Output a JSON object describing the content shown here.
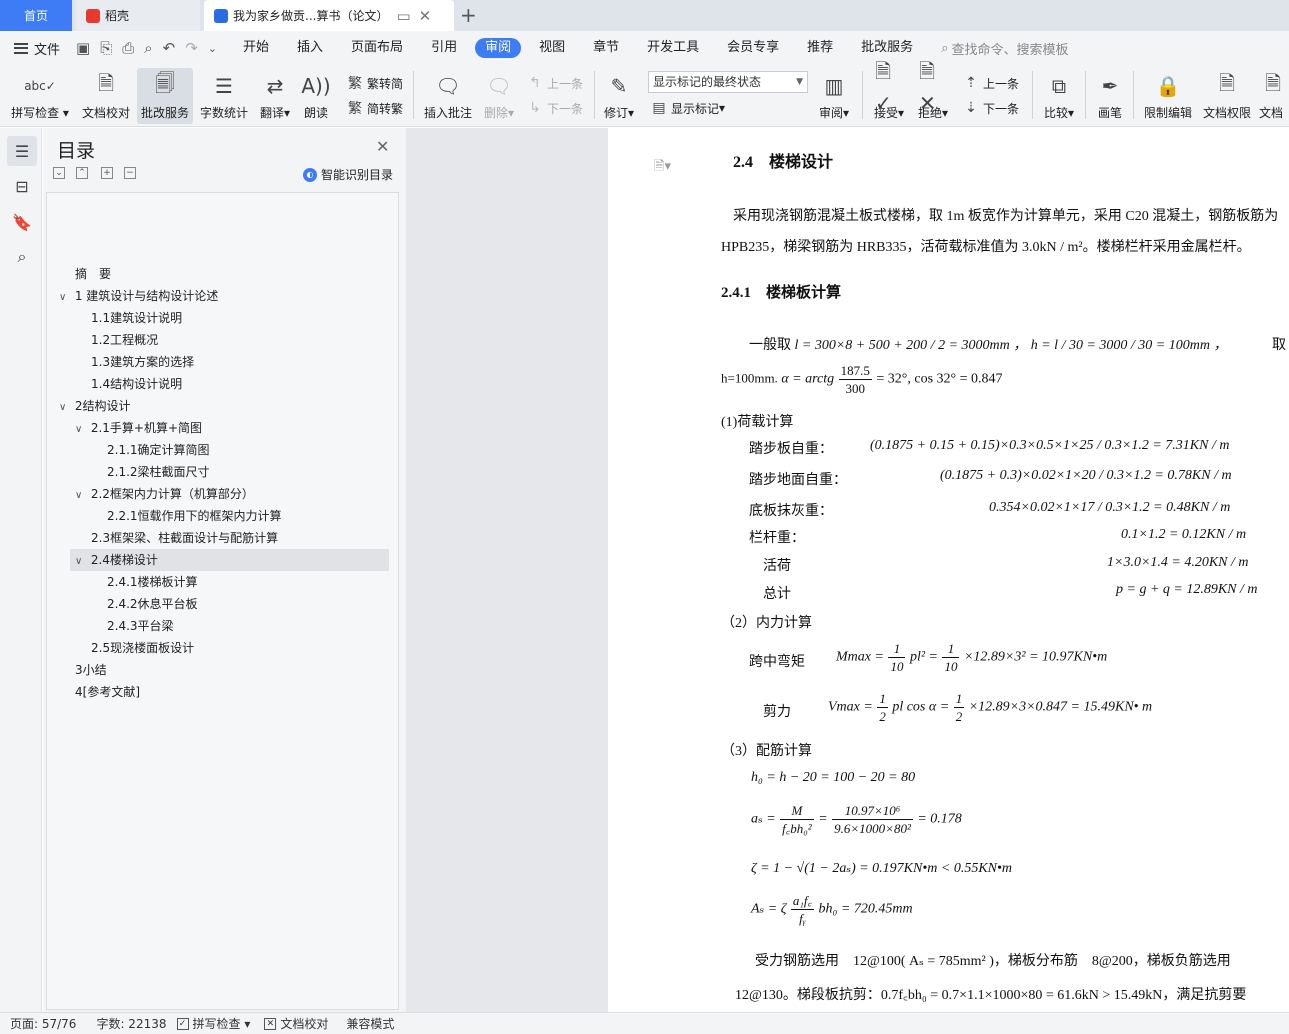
{
  "tabs": {
    "home": "首页",
    "daoke": "稻壳",
    "doc": "我为家乡做贡...算书（论文）",
    "add": "+"
  },
  "menubar": {
    "file": "文件",
    "items": [
      "开始",
      "插入",
      "页面布局",
      "引用",
      "审阅",
      "视图",
      "章节",
      "开发工具",
      "会员专享",
      "推荐",
      "批改服务"
    ],
    "active": "审阅",
    "search": "查找命令、搜索模板"
  },
  "ribbon": {
    "spell_check": "拼写检查",
    "doc_proof": "文档校对",
    "correction_service": "批改服务",
    "word_count": "字数统计",
    "translate": "翻译",
    "read_aloud": "朗读",
    "trad_to_simp": "繁转简",
    "simp_to_trad": "简转繁",
    "insert_comment": "插入批注",
    "delete": "删除",
    "prev_comment": "上一条",
    "next_comment": "下一条",
    "track_changes": "修订",
    "markup_state": "显示标记的最终状态",
    "show_markup": "显示标记",
    "review": "审阅",
    "accept": "接受",
    "reject": "拒绝",
    "prev_change": "上一条",
    "next_change": "下一条",
    "compare": "比较",
    "pen": "画笔",
    "restrict_edit": "限制编辑",
    "doc_permission": "文档权限",
    "doc_more": "文档"
  },
  "toc": {
    "title": "目录",
    "smart": "智能识别目录",
    "items": [
      {
        "label": "摘　要"
      },
      {
        "label": "1  建筑设计与结构设计论述"
      },
      {
        "label": "1.1建筑设计说明"
      },
      {
        "label": "1.2工程概况"
      },
      {
        "label": "1.3建筑方案的选择"
      },
      {
        "label": "1.4结构设计说明"
      },
      {
        "label": "2结构设计"
      },
      {
        "label": "2.1手算+机算+简图"
      },
      {
        "label": "2.1.1确定计算简图"
      },
      {
        "label": "2.1.2梁柱截面尺寸"
      },
      {
        "label": "2.2框架内力计算（机算部分）"
      },
      {
        "label": "2.2.1恒载作用下的框架内力计算"
      },
      {
        "label": "2.3框架梁、柱截面设计与配筋计算"
      },
      {
        "label": "2.4楼梯设计"
      },
      {
        "label": "2.4.1楼梯板计算"
      },
      {
        "label": "2.4.2休息平台板"
      },
      {
        "label": "2.4.3平台梁"
      },
      {
        "label": "2.5现浇楼面板设计"
      },
      {
        "label": "3小结"
      },
      {
        "label": "4[参考文献]"
      }
    ]
  },
  "doc": {
    "h1": "2.4　楼梯设计",
    "p1a": "采用现浇钢筋混凝土板式楼梯，取 1m 板宽作为计算单元，采用 C20 混凝土，钢筋板筋为",
    "p1b": "HPB235，梯梁钢筋为 HRB335，活荷载标准值为 3.0kN / m²。楼梯栏杆采用金属栏杆。",
    "h2": "2.4.1　楼梯板计算",
    "p2a_pre": "一般取",
    "p2a_math": "l = 300×8 + 500 + 200 / 2 = 3000mm ，  h = l / 30 = 3000 / 30 = 100mm ，",
    "p2a_tail": "取",
    "p2b_pre": "h=100mm.",
    "p2b_alpha": "α = arctg",
    "p2b_num": "187.5",
    "p2b_den": "300",
    "p2b_tail": "= 32°, cos 32° = 0.847",
    "load_heading": "(1)荷载计算",
    "loads": [
      {
        "label": "踏步板自重：",
        "formula": "(0.1875 + 0.15 + 0.15)×0.3×0.5×1×25 / 0.3×1.2 = 7.31KN / m"
      },
      {
        "label": "踏步地面自重：",
        "formula": "(0.1875 + 0.3)×0.02×1×20 / 0.3×1.2 = 0.78KN / m"
      },
      {
        "label": "底板抹灰重：",
        "formula": "0.354×0.02×1×17 / 0.3×1.2 = 0.48KN / m"
      },
      {
        "label": "栏杆重：",
        "formula": "0.1×1.2 = 0.12KN / m"
      },
      {
        "label": "活荷",
        "formula": "1×3.0×1.4 = 4.20KN / m"
      },
      {
        "label": "总计",
        "formula": "p = g + q = 12.89KN / m"
      }
    ],
    "internal_heading": "（2）内力计算",
    "moment_label": "跨中弯矩",
    "moment_lhs": "Mmax =",
    "moment_f1_num": "1",
    "moment_f1_den": "10",
    "moment_mid": "pl² =",
    "moment_f2_num": "1",
    "moment_f2_den": "10",
    "moment_rhs": "×12.89×3² = 10.97KN•m",
    "shear_label": "剪力",
    "shear_lhs": "Vmax =",
    "shear_f1_num": "1",
    "shear_f1_den": "2",
    "shear_mid": "pl cos α =",
    "shear_f2_num": "1",
    "shear_f2_den": "2",
    "shear_rhs": "×12.89×3×0.847 = 15.49KN• m",
    "rebar_heading": "（3）配筋计算",
    "h0": "h₀ = h − 20 = 100 − 20 = 80",
    "as_lhs": "aₛ =",
    "as_f1_num": "M",
    "as_f1_den": "f꜀bh₀²",
    "as_eq": "=",
    "as_f2_num": "10.97×10⁶",
    "as_f2_den": "9.6×1000×80²",
    "as_rhs": "= 0.178",
    "zeta": "ζ = 1 − √(1 − 2aₛ) = 0.197KN•m < 0.55KN•m",
    "As_lhs": "Aₛ = ζ",
    "As_num": "a₁f꜀",
    "As_den": "fᵧ",
    "As_rhs": "bh₀ = 720.45mm",
    "p3a": "受力钢筋选用　12@100( Aₛ = 785mm² )，梯板分布筋　8@200，梯板负筋选用",
    "p3b": "12@130。梯段板抗剪：0.7f꜀bh₀ = 0.7×1.1×1000×80 = 61.6kN > 15.49kN，满足抗剪要"
  },
  "status": {
    "page": "页面: 57/76",
    "words": "字数: 22138",
    "spell": "拼写检查",
    "proof": "文档校对",
    "compat": "兼容模式"
  },
  "colors": {
    "accent": "#3d7cf5",
    "daoke_logo": "#e8382f"
  }
}
